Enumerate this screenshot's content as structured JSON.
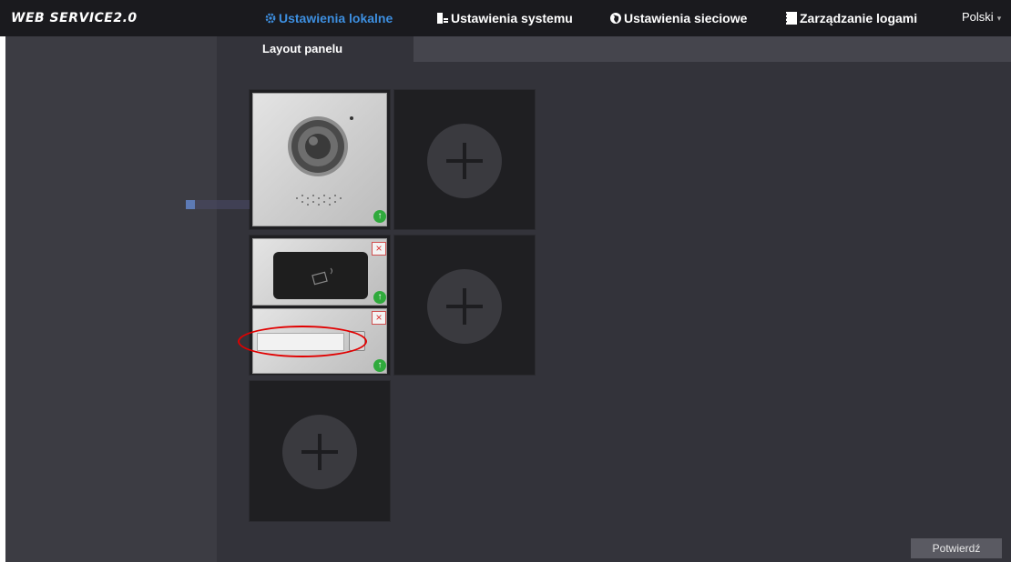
{
  "app": {
    "logo": "WEB SERVICE2.0"
  },
  "nav": {
    "tabs": [
      {
        "label": "Ustawienia lokalne",
        "icon": "gear-icon",
        "active": true
      },
      {
        "label": "Ustawienia systemu",
        "icon": "system-icon",
        "active": false
      },
      {
        "label": "Ustawienia sieciowe",
        "icon": "globe-icon",
        "active": false
      },
      {
        "label": "Zarządzanie logami",
        "icon": "log-icon",
        "active": false
      }
    ],
    "language": "Polski"
  },
  "subtab": {
    "label": "Layout panelu"
  },
  "panel": {
    "modules": [
      {
        "type": "camera-module",
        "icons": [
          "up-arrow-icon"
        ]
      },
      {
        "type": "card-reader-module",
        "icons": [
          "delete-icon",
          "up-arrow-icon"
        ]
      },
      {
        "type": "button-module",
        "icons": [
          "delete-icon",
          "up-arrow-icon"
        ]
      }
    ],
    "empty_slots": 3
  },
  "footer": {
    "confirm_label": "Potwierdź"
  },
  "colors": {
    "accent": "#3d8fe0",
    "topbar": "#1a1a1e",
    "panel_bg": "#33333a",
    "up_button": "#2faa3c",
    "annotation": "#e10000"
  }
}
